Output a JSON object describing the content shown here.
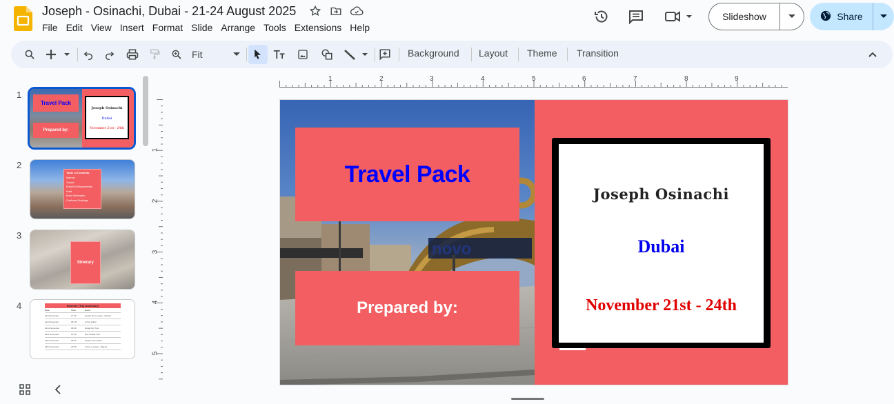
{
  "app": {
    "doc_title": "Joseph - Osinachi, Dubai - 21-24 August 2025",
    "menu": [
      "File",
      "Edit",
      "View",
      "Insert",
      "Format",
      "Slide",
      "Arrange",
      "Tools",
      "Extensions",
      "Help"
    ],
    "slideshow_label": "Slideshow",
    "share_label": "Share"
  },
  "toolbar": {
    "zoom_label": "Fit",
    "background_label": "Background",
    "layout_label": "Layout",
    "theme_label": "Theme",
    "transition_label": "Transition"
  },
  "filmstrip": {
    "numbers": [
      "1",
      "2",
      "3",
      "4"
    ],
    "thumb1": {
      "title": "Travel Pack",
      "prepared": "Prepared by:",
      "name": "Joseph Osinachi",
      "city": "Dubai",
      "date": "November 21st - 24th"
    },
    "thumb2": {
      "heading": "Table of Contents",
      "items": [
        "Itinerary",
        "Travels",
        "Entry/Exit Requirements",
        "Hotel",
        "Event Information",
        "Confirmed Bookings"
      ]
    },
    "thumb3": {
      "label": "Itinerary"
    },
    "thumb4": {
      "heading": "Itinerary (Trip Summary)",
      "headers": [
        "Date",
        "Time",
        "Event"
      ],
      "rows": [
        [
          "21st November",
          "17:50",
          "Depart From Lagos - Nigeria"
        ],
        [
          "21st November",
          "05:10*",
          "Arrive Dubai"
        ],
        [
          "22nd November",
          "09:00",
          "Dubai City Tour"
        ],
        [
          "23rd November",
          "10:00",
          "Burj Khalifa Visit"
        ],
        [
          "24th November",
          "18:30",
          "Depart from Dubai"
        ],
        [
          "24th November",
          "23:50",
          "Arrive in Lagos - Nigeria"
        ]
      ]
    }
  },
  "ruler": {
    "h_labels": [
      "1",
      "2",
      "3",
      "4",
      "5",
      "6",
      "7",
      "8",
      "9"
    ],
    "v_labels": [
      "1",
      "2",
      "3",
      "4",
      "5"
    ]
  },
  "slide": {
    "title": "Travel Pack",
    "prepared_by": "Prepared by:",
    "name": "Joseph Osinachi",
    "city": "Dubai",
    "dates": "November 21st - 24th"
  },
  "colors": {
    "slide_red": "#f25e61",
    "title_blue": "#0000ff",
    "date_red": "#e00000",
    "share_bg": "#c2e7ff",
    "toolbar_bg": "#edf2fa",
    "selection_blue": "#0b57d0"
  }
}
